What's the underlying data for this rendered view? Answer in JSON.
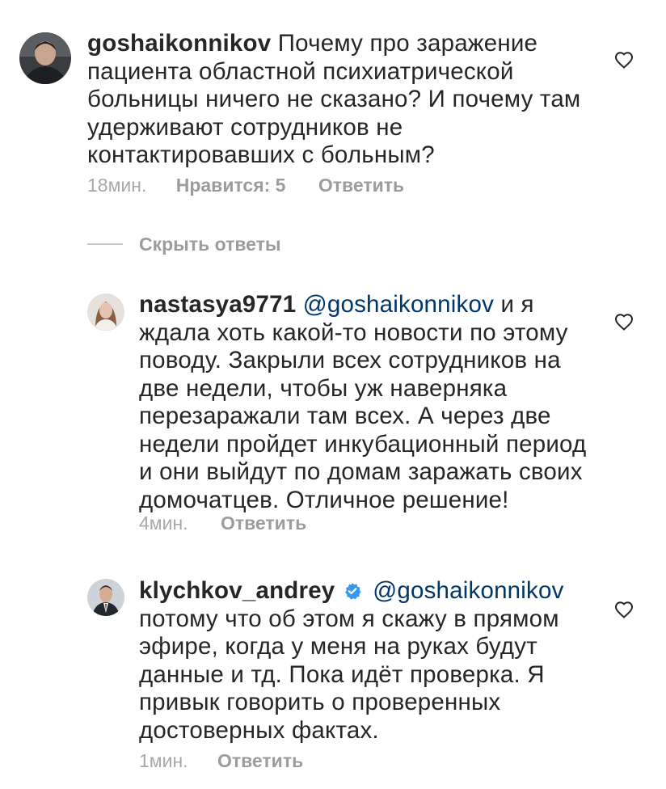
{
  "comments": [
    {
      "username": "goshaikonnikov",
      "mention": "",
      "text_lines": [
        "Почему про заражение",
        "пациента областной психиатрической",
        "больницы ничего не сказано? И почему там",
        "удерживают сотрудников не",
        "контактировавших с больным?"
      ],
      "time": "18мин.",
      "likes": "Нравится: 5",
      "reply": "Ответить",
      "avatar_icon": "user-avatar-photo",
      "like_icon": "heart-outline-icon"
    },
    {
      "username": "nastasya9771",
      "mention": "@goshaikonnikov",
      "text_lines": [
        "и я",
        "ждала хоть какой-то новости по этому",
        "поводу. Закрыли всех сотрудников на",
        "две недели, чтобы уж наверняка",
        "перезаражали там всех. А через две",
        "недели пройдет инкубационный период",
        "и они выйдут по домам заражать своих",
        "домочатцев. Отличное решение!"
      ],
      "time": "4мин.",
      "reply": "Ответить",
      "avatar_icon": "user-avatar-photo",
      "like_icon": "heart-outline-icon"
    },
    {
      "username": "klychkov_andrey",
      "mention": "@goshaikonnikov",
      "verified": true,
      "verified_icon": "verified-badge-icon",
      "verified_color": "#3897f0",
      "text_lines": [
        "потому что об этом я скажу в прямом",
        "эфире, когда у меня на руках будут",
        "данные и тд. Пока идёт проверка. Я",
        "привык говорить о проверенных",
        "достоверных фактах."
      ],
      "time": "1мин.",
      "reply": "Ответить",
      "avatar_icon": "user-avatar-photo",
      "like_icon": "heart-outline-icon"
    }
  ],
  "hide_replies_label": "Скрыть ответы",
  "colors": {
    "text": "#262626",
    "mention": "#00376b",
    "meta": "#a8a8a8"
  }
}
